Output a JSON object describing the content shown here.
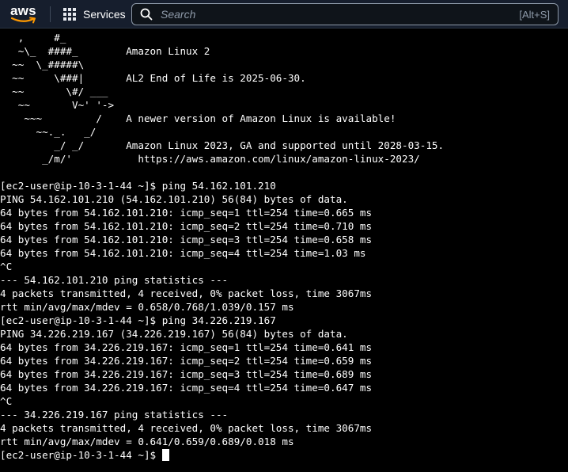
{
  "topbar": {
    "logo_text": "aws",
    "services_label": "Services",
    "search_placeholder": "Search",
    "search_shortcut": "[Alt+S]"
  },
  "colors": {
    "topbar_bg": "#161e2d",
    "aws_orange": "#ff9900",
    "terminal_bg": "#000000",
    "terminal_fg": "#ffffff"
  },
  "terminal": {
    "motd": [
      "   ,     #_",
      "   ~\\_  ####_        Amazon Linux 2",
      "  ~~  \\_#####\\",
      "  ~~     \\###|       AL2 End of Life is 2025-06-30.",
      "  ~~       \\#/ ___",
      "   ~~       V~' '->",
      "    ~~~         /    A newer version of Amazon Linux is available!",
      "      ~~._.   _/",
      "         _/ _/       Amazon Linux 2023, GA and supported until 2028-03-15.",
      "       _/m/'           https://aws.amazon.com/linux/amazon-linux-2023/"
    ],
    "lines": [
      "[ec2-user@ip-10-3-1-44 ~]$ ping 54.162.101.210",
      "PING 54.162.101.210 (54.162.101.210) 56(84) bytes of data.",
      "64 bytes from 54.162.101.210: icmp_seq=1 ttl=254 time=0.665 ms",
      "64 bytes from 54.162.101.210: icmp_seq=2 ttl=254 time=0.710 ms",
      "64 bytes from 54.162.101.210: icmp_seq=3 ttl=254 time=0.658 ms",
      "64 bytes from 54.162.101.210: icmp_seq=4 ttl=254 time=1.03 ms",
      "^C",
      "--- 54.162.101.210 ping statistics ---",
      "4 packets transmitted, 4 received, 0% packet loss, time 3067ms",
      "rtt min/avg/max/mdev = 0.658/0.768/1.039/0.157 ms",
      "[ec2-user@ip-10-3-1-44 ~]$ ping 34.226.219.167",
      "PING 34.226.219.167 (34.226.219.167) 56(84) bytes of data.",
      "64 bytes from 34.226.219.167: icmp_seq=1 ttl=254 time=0.641 ms",
      "64 bytes from 34.226.219.167: icmp_seq=2 ttl=254 time=0.659 ms",
      "64 bytes from 34.226.219.167: icmp_seq=3 ttl=254 time=0.689 ms",
      "64 bytes from 34.226.219.167: icmp_seq=4 ttl=254 time=0.647 ms",
      "^C",
      "--- 34.226.219.167 ping statistics ---",
      "4 packets transmitted, 4 received, 0% packet loss, time 3067ms",
      "rtt min/avg/max/mdev = 0.641/0.659/0.689/0.018 ms"
    ],
    "prompt": "[ec2-user@ip-10-3-1-44 ~]$"
  }
}
